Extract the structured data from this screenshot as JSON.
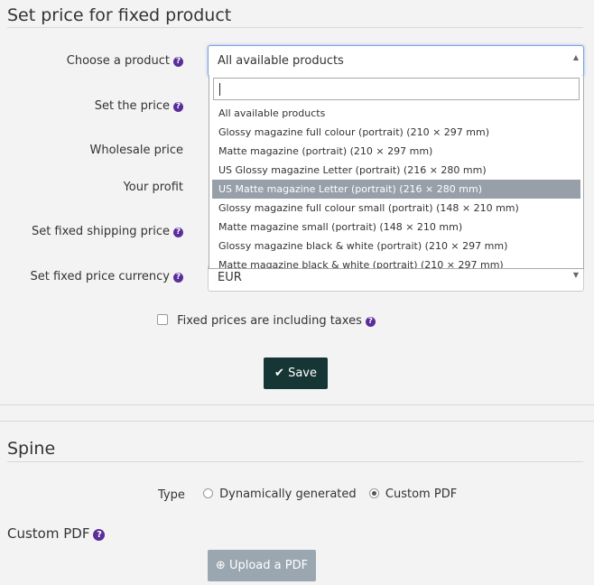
{
  "price_section": {
    "title": "Set price for fixed product",
    "product_label": "Choose a product",
    "product_value": "All available products",
    "price_label": "Set the price",
    "wholesale_label": "Wholesale price",
    "profit_label": "Your profit",
    "shipping_label": "Set fixed shipping price",
    "currency_label": "Set fixed price currency",
    "currency_value": "EUR",
    "taxes_label": "Fixed prices are including taxes",
    "save_label": "Save",
    "dropdown_options": [
      "All available products",
      "Glossy magazine full colour (portrait) (210 × 297 mm)",
      "Matte magazine (portrait) (210 × 297 mm)",
      "US Glossy magazine Letter (portrait) (216 × 280 mm)",
      "US Matte magazine Letter (portrait) (216 × 280 mm)",
      "Glossy magazine full colour small (portrait) (148 × 210 mm)",
      "Matte magazine small (portrait) (148 × 210 mm)",
      "Glossy magazine black & white (portrait) (210 × 297 mm)",
      "Matte magazine black & white (portrait) (210 × 297 mm)"
    ],
    "highlighted_option_index": 4
  },
  "spine_section": {
    "title": "Spine",
    "type_label": "Type",
    "option_dynamic": "Dynamically generated",
    "option_custom": "Custom PDF",
    "selected": "Custom PDF"
  },
  "custom_pdf": {
    "title": "Custom PDF",
    "upload_label": "Upload a PDF"
  },
  "colors": {
    "save_button": "#163636",
    "upload_button": "#9aa6b0",
    "highlight": "#979fa9",
    "help_icon": "#5b2d9a"
  }
}
